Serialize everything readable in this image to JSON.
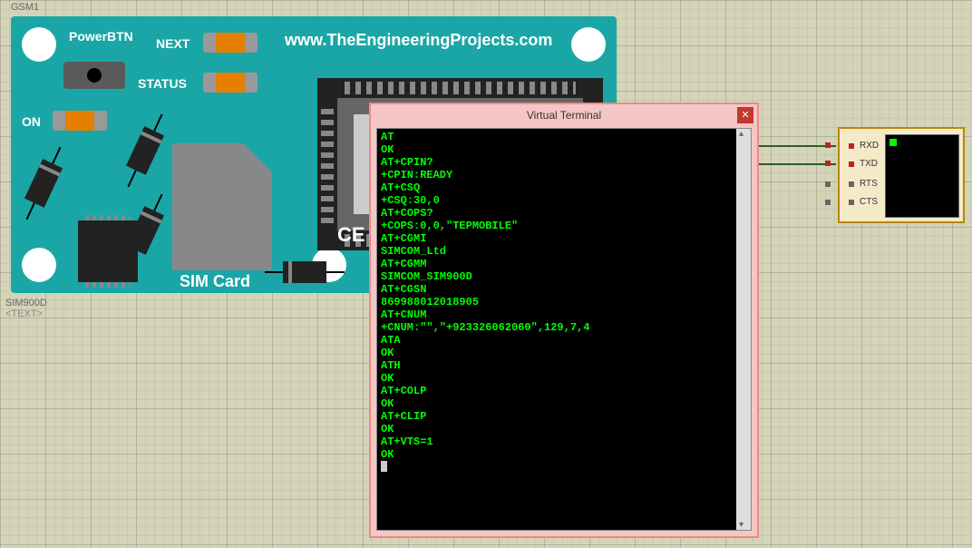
{
  "schematic": {
    "component_ref": "GSM1",
    "component_part": "SIM900D",
    "component_value": "<TEXT>"
  },
  "module": {
    "powerbtn_label": "PowerBTN",
    "next_label": "NEXT",
    "status_label": "STATUS",
    "on_label": "ON",
    "simcard_label": "SIM Card",
    "ce_text": "CE",
    "url": "www.TheEngineeringProjects.com"
  },
  "serial_display": {
    "pins": [
      "RXD",
      "TXD",
      "RTS",
      "CTS"
    ]
  },
  "virtual_terminal": {
    "title": "Virtual Terminal",
    "lines": [
      "AT",
      "OK",
      "AT+CPIN?",
      "+CPIN:READY",
      "AT+CSQ",
      "+CSQ:30,0",
      "AT+COPS?",
      "+COPS:0,0,\"TEPMOBILE\"",
      "AT+CGMI",
      "SIMCOM_Ltd",
      "AT+CGMM",
      "SIMCOM_SIM900D",
      "AT+CGSN",
      "869988012018905",
      "AT+CNUM",
      "+CNUM:\"\",\"+923326062060\",129,7,4",
      "ATA",
      "OK",
      "ATH",
      "OK",
      "AT+COLP",
      "OK",
      "AT+CLIP",
      "OK",
      "AT+VTS=1",
      "OK"
    ]
  }
}
